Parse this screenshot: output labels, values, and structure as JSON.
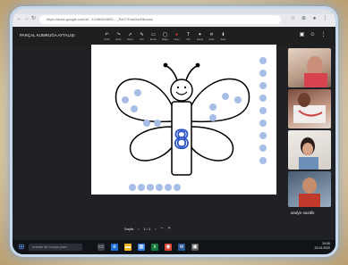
{
  "browser": {
    "url": "https://drive.google.com/a/...12x6k0Z6t0S/..._RzG7DmdXwF8mxxe",
    "nav": {
      "back": "←",
      "forward": "→",
      "reload": "↻"
    }
  },
  "meeting": {
    "title": "PARÇAL KUMRUĞA AYTALIŞI"
  },
  "toolbar": {
    "tools": [
      {
        "label": "Undo",
        "glyph": "↶"
      },
      {
        "label": "Redo",
        "glyph": "↷"
      },
      {
        "label": "Select",
        "glyph": "➚"
      },
      {
        "label": "Pen",
        "glyph": "✎"
      },
      {
        "label": "Eraser",
        "glyph": "▭"
      },
      {
        "label": "Shape",
        "glyph": "◯"
      },
      {
        "label": "Laser",
        "glyph": "●"
      },
      {
        "label": "Text",
        "glyph": "T"
      },
      {
        "label": "Stamp",
        "glyph": "✦"
      },
      {
        "label": "Clear",
        "glyph": "✕"
      },
      {
        "label": "Save",
        "glyph": "⬇"
      }
    ]
  },
  "whiteboard": {
    "digit": "8"
  },
  "participants": {
    "active_name": "andye nazdik"
  },
  "zoom": {
    "label": "Sayfa",
    "value": "1 / 1"
  },
  "taskbar": {
    "search_placeholder": "Aramak için buraya yazın",
    "time": "20:06",
    "date": "23.04.2020"
  },
  "colors": {
    "dot": "#a8bde6",
    "accent_blue": "#2a53c7",
    "stop_red": "#ea4335"
  }
}
